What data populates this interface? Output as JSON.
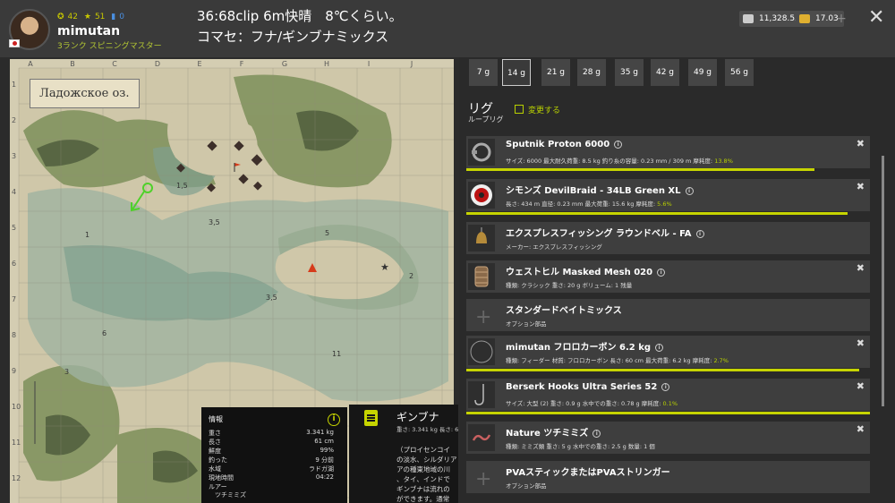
{
  "player": {
    "stat1": "42",
    "stat2": "51",
    "stat3": "0",
    "username": "mimutan",
    "rank": "3ランク スピニングマスター"
  },
  "header": {
    "line1": "36:68clip 6m快晴　8℃くらい。",
    "line2": "コマセ：フナ/ギンブナミックス"
  },
  "currency": {
    "silver": "11,328.53",
    "gold": "17.03",
    "plus": "+"
  },
  "close_label": "✕",
  "map": {
    "lake_name": "Ладожское оз.",
    "columns": [
      "A",
      "B",
      "C",
      "D",
      "E",
      "F",
      "G",
      "H",
      "I",
      "J"
    ],
    "rows": [
      "1",
      "2",
      "3",
      "4",
      "5",
      "6",
      "7",
      "8",
      "9",
      "10",
      "11",
      "12"
    ],
    "depths": [
      "1,5",
      "1",
      "3,5",
      "3,5",
      "5",
      "2",
      "6",
      "3",
      "11",
      "6"
    ]
  },
  "fish_info": {
    "title": "情報",
    "rows": [
      {
        "key": "重さ",
        "value": "3.341 kg"
      },
      {
        "key": "長さ",
        "value": "61 cm"
      },
      {
        "key": "鮮度",
        "value": "99%"
      },
      {
        "key": "釣った",
        "value": "9 分前"
      },
      {
        "key": "水域",
        "value": "ラドガ湖"
      },
      {
        "key": "現地時間",
        "value": "04:22"
      },
      {
        "key": "ルアー",
        "value": ""
      },
      {
        "key": "　ツチミミズ",
        "value": ""
      }
    ]
  },
  "fish_desc": {
    "title": "ギンブナ",
    "sub": "重さ: 3.341 kg 長さ: 6",
    "text": "（プロイセンコイ\nの淡水、シルダリア\nアの種東地域の川\n、タイ、インドで\nギンブナは流れの\nができます。通常"
  },
  "weights": [
    "7 g",
    "14 g",
    "21 g",
    "28 g",
    "35 g",
    "42 g",
    "49 g",
    "56 g"
  ],
  "selected_weight": "14 g",
  "rig": {
    "title": "リグ",
    "subtitle": "ループリグ",
    "change_label": "変更する"
  },
  "rig_items": [
    {
      "name": "Sputnik Proton 6000",
      "details": "サイズ: 6000 最大耐久荷重: 8.5 kg 釣り糸の容量: 0.23 mm / 309 m 摩耗度:",
      "wear": "13.8%",
      "icon": "reel-icon"
    },
    {
      "name": "シモンズ DevilBraid - 34LB Green XL",
      "details": "長さ: 434 m 直径: 0.23 mm 最大荷重: 15.6 kg 摩耗度:",
      "wear": "5.6%",
      "icon": "line-spool-icon"
    },
    {
      "name": "エクスプレスフィッシング ラウンドベル - FA",
      "details": "メーカー: エクスプレスフィッシング",
      "wear": "",
      "icon": "bell-icon"
    },
    {
      "name": "ウェストヒル Masked Mesh 020",
      "details": "種類: クラシック 重さ: 20 g ボリューム: 1 残量",
      "wear": "",
      "icon": "feeder-icon"
    },
    {
      "name": "スタンダードベイトミックス",
      "details": "オプション部品",
      "wear": "",
      "icon": "add-icon"
    },
    {
      "name": "mimutan フロロカーボン 6.2 kg",
      "details": "種類: フィーダー 材質: フロロカーボン 長さ: 60 cm 最大荷重: 6.2 kg 摩耗度:",
      "wear": "2.7%",
      "icon": "leader-icon"
    },
    {
      "name": "Berserk Hooks Ultra Series 52",
      "details": "サイズ: 大型 (2) 重さ: 0.9 g 水中での重さ: 0.78 g 摩耗度:",
      "wear": "0.1%",
      "icon": "hook-icon"
    },
    {
      "name": "Nature ツチミミズ",
      "details": "種類: ミミズ類 重さ: 5 g 水中での重さ: 2.5 g 数量: 1 個",
      "wear": "",
      "icon": "worm-icon"
    },
    {
      "name": "PVAスティックまたはPVAストリンガー",
      "details": "オプション部品",
      "wear": "",
      "icon": "add-icon"
    }
  ],
  "wear_bars": [
    0.862,
    0.944,
    0,
    0,
    0,
    0.973,
    0.999,
    0,
    0
  ],
  "colors": {
    "accent": "#c6d400",
    "panel": "#3e3e3e",
    "map_paper": "#cfc7a9"
  }
}
